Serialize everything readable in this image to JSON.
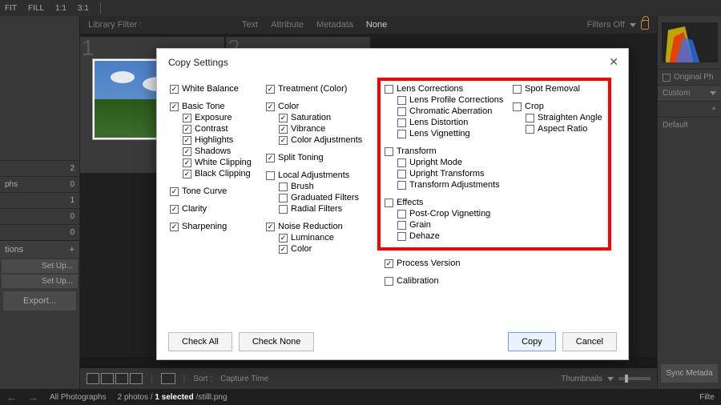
{
  "top_strip": {
    "fit": "FIT",
    "fill": "FILL",
    "ratio1": "1:1",
    "ratio2": "3:1"
  },
  "filter_bar": {
    "label": "Library Filter :",
    "tabs": [
      "Text",
      "Attribute",
      "Metadata",
      "None"
    ],
    "filters_off": "Filters Off"
  },
  "slots": {
    "num1": "1",
    "num2": "2"
  },
  "left_panel": {
    "rows": [
      {
        "label": "",
        "value": "2"
      },
      {
        "label": "phs",
        "value": "0"
      },
      {
        "label": "",
        "value": "1"
      },
      {
        "label": "",
        "value": "0"
      },
      {
        "label": "",
        "value": "0"
      }
    ],
    "tions_header": "tions",
    "setup1": "Set Up...",
    "setup2": "Set Up...",
    "export": "Export..."
  },
  "right_panel": {
    "original": "Original Ph",
    "custom": "Custom",
    "plus": "+",
    "default": "Default",
    "sync": "Sync Metada"
  },
  "bottom_bar": {
    "sort": "Sort :",
    "sort_by": "Capture Time",
    "thumbnails": "Thumbnails"
  },
  "status_bar": {
    "all": "All Photographs",
    "count": "2 photos /",
    "selected": "1 selected",
    "filename": "/stilll.png",
    "filter": "Filte"
  },
  "dialog": {
    "title": "Copy Settings",
    "check_all": "Check All",
    "check_none": "Check None",
    "copy": "Copy",
    "cancel": "Cancel",
    "col1": [
      {
        "label": "White Balance",
        "checked": true,
        "children": []
      },
      {
        "label": "Basic Tone",
        "checked": true,
        "children": [
          {
            "label": "Exposure",
            "checked": true
          },
          {
            "label": "Contrast",
            "checked": true
          },
          {
            "label": "Highlights",
            "checked": true
          },
          {
            "label": "Shadows",
            "checked": true
          },
          {
            "label": "White Clipping",
            "checked": true
          },
          {
            "label": "Black Clipping",
            "checked": true
          }
        ]
      },
      {
        "label": "Tone Curve",
        "checked": true,
        "children": []
      },
      {
        "label": "Clarity",
        "checked": true,
        "children": []
      },
      {
        "label": "Sharpening",
        "checked": true,
        "children": []
      }
    ],
    "col2": [
      {
        "label": "Treatment (Color)",
        "checked": true,
        "children": []
      },
      {
        "label": "Color",
        "checked": true,
        "children": [
          {
            "label": "Saturation",
            "checked": true
          },
          {
            "label": "Vibrance",
            "checked": true
          },
          {
            "label": "Color Adjustments",
            "checked": true
          }
        ]
      },
      {
        "label": "Split Toning",
        "checked": true,
        "children": []
      },
      {
        "label": "Local Adjustments",
        "checked": false,
        "children": [
          {
            "label": "Brush",
            "checked": false
          },
          {
            "label": "Graduated Filters",
            "checked": false
          },
          {
            "label": "Radial Filters",
            "checked": false
          }
        ]
      },
      {
        "label": "Noise Reduction",
        "checked": true,
        "children": [
          {
            "label": "Luminance",
            "checked": true
          },
          {
            "label": "Color",
            "checked": true
          }
        ]
      }
    ],
    "col3": [
      {
        "label": "Lens Corrections",
        "checked": false,
        "children": [
          {
            "label": "Lens Profile Corrections",
            "checked": false
          },
          {
            "label": "Chromatic Aberration",
            "checked": false
          },
          {
            "label": "Lens Distortion",
            "checked": false
          },
          {
            "label": "Lens Vignetting",
            "checked": false
          }
        ]
      },
      {
        "label": "Transform",
        "checked": false,
        "children": [
          {
            "label": "Upright Mode",
            "checked": false
          },
          {
            "label": "Upright Transforms",
            "checked": false
          },
          {
            "label": "Transform Adjustments",
            "checked": false
          }
        ]
      },
      {
        "label": "Effects",
        "checked": false,
        "children": [
          {
            "label": "Post-Crop Vignetting",
            "checked": false
          },
          {
            "label": "Grain",
            "checked": false
          },
          {
            "label": "Dehaze",
            "checked": false
          }
        ]
      }
    ],
    "col4": [
      {
        "label": "Spot Removal",
        "checked": false,
        "children": []
      },
      {
        "label": "Crop",
        "checked": false,
        "children": [
          {
            "label": "Straighten Angle",
            "checked": false
          },
          {
            "label": "Aspect Ratio",
            "checked": false
          }
        ]
      }
    ],
    "col5": [
      {
        "label": "Process Version",
        "checked": true,
        "children": []
      },
      {
        "label": "Calibration",
        "checked": false,
        "children": []
      }
    ]
  }
}
